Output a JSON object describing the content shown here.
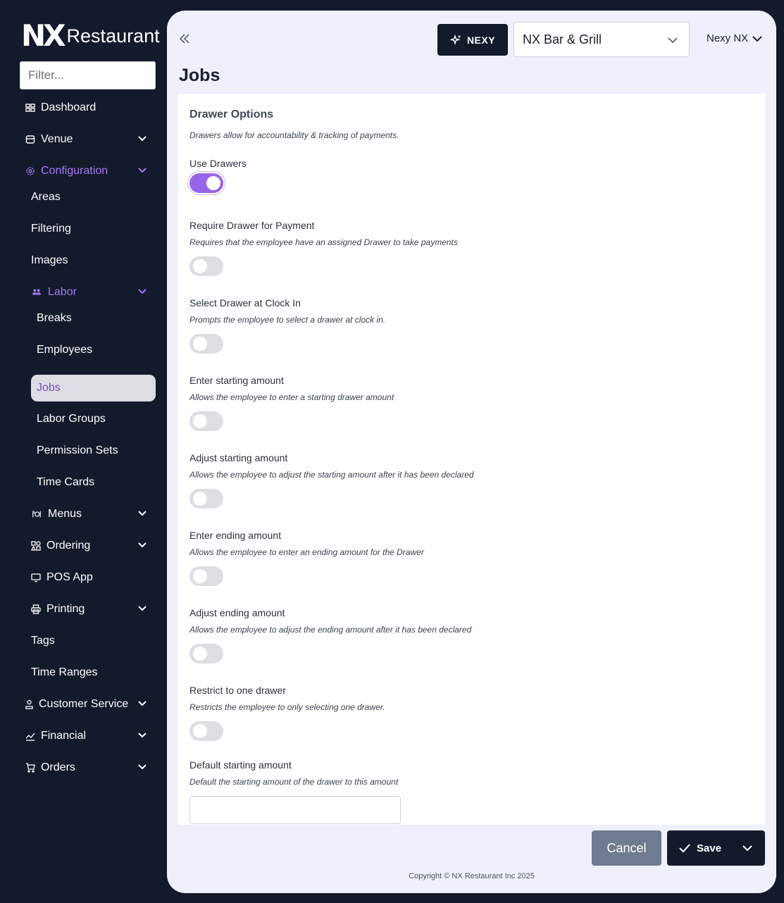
{
  "brand": {
    "mark": "NX",
    "name": "Restaurant"
  },
  "filter": {
    "placeholder": "Filter..."
  },
  "sidebar": {
    "items": [
      {
        "key": "dashboard",
        "label": "Dashboard",
        "icon": "dashboard-icon"
      },
      {
        "key": "venue",
        "label": "Venue",
        "icon": "venue-icon",
        "expandable": true
      },
      {
        "key": "configuration",
        "label": "Configuration",
        "icon": "gear-icon",
        "expandable": true,
        "expanded": true
      },
      {
        "key": "areas",
        "label": "Areas"
      },
      {
        "key": "filtering",
        "label": "Filtering"
      },
      {
        "key": "images",
        "label": "Images"
      },
      {
        "key": "labor",
        "label": "Labor",
        "icon": "users-icon",
        "expandable": true,
        "expanded": true
      },
      {
        "key": "breaks",
        "label": "Breaks"
      },
      {
        "key": "employees",
        "label": "Employees"
      },
      {
        "key": "jobs",
        "label": "Jobs",
        "selected": true
      },
      {
        "key": "labor-groups",
        "label": "Labor Groups"
      },
      {
        "key": "permission-sets",
        "label": "Permission Sets"
      },
      {
        "key": "time-cards",
        "label": "Time Cards"
      },
      {
        "key": "menus",
        "label": "Menus",
        "icon": "menu-icon",
        "expandable": true
      },
      {
        "key": "ordering",
        "label": "Ordering",
        "icon": "ordering-icon",
        "expandable": true
      },
      {
        "key": "pos-app",
        "label": "POS App",
        "icon": "monitor-icon"
      },
      {
        "key": "printing",
        "label": "Printing",
        "icon": "printer-icon",
        "expandable": true
      },
      {
        "key": "tags",
        "label": "Tags"
      },
      {
        "key": "time-ranges",
        "label": "Time Ranges"
      },
      {
        "key": "customer-service",
        "label": "Customer Service",
        "icon": "service-icon",
        "expandable": true
      },
      {
        "key": "financial",
        "label": "Financial",
        "icon": "chart-icon",
        "expandable": true
      },
      {
        "key": "orders",
        "label": "Orders",
        "icon": "cart-icon",
        "expandable": true
      }
    ]
  },
  "header": {
    "nexy_label": "NEXY",
    "venue": "NX Bar & Grill",
    "user": "Nexy NX"
  },
  "page": {
    "title": "Jobs"
  },
  "drawer": {
    "title": "Drawer Options",
    "description": "Drawers allow for accountability & tracking of payments.",
    "use_drawers": {
      "label": "Use Drawers",
      "enabled": true
    },
    "options": [
      {
        "label": "Require Drawer for Payment",
        "desc": "Requires that the employee have an assigned Drawer to take payments",
        "enabled": false
      },
      {
        "label": "Select Drawer at Clock In",
        "desc": "Prompts the employee to select a drawer at clock in.",
        "enabled": false
      },
      {
        "label": "Enter starting amount",
        "desc": "Allows the employee to enter a starting drawer amount",
        "enabled": false
      },
      {
        "label": "Adjust starting amount",
        "desc": "Allows the employee to adjust the starting amount after it has been declared",
        "enabled": false
      },
      {
        "label": "Enter ending amount",
        "desc": "Allows the employee to enter an ending amount for the Drawer",
        "enabled": false
      },
      {
        "label": "Adjust ending amount",
        "desc": "Allows the employee to adjust the ending amount after it has been declared",
        "enabled": false
      },
      {
        "label": "Restrict to one drawer",
        "desc": "Restricts the employee to only selecting one drawer.",
        "enabled": false
      }
    ],
    "default_amount": {
      "label": "Default starting amount",
      "desc": "Default the starting amount of the drawer to this amount",
      "value": ""
    }
  },
  "actions": {
    "cancel": "Cancel",
    "save": "Save"
  },
  "footer": {
    "copyright": "Copyright © NX Restaurant Inc 2025"
  },
  "colors": {
    "sidebar_bg": "#131a2c",
    "accent": "#9665ea",
    "panel_bg": "#eef1fb"
  }
}
